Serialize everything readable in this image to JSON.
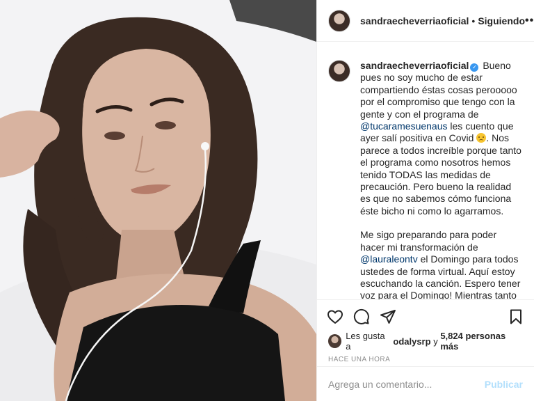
{
  "post": {
    "username": "sandraecheverriaoficial",
    "separator": "•",
    "follow_status": "Siguiendo",
    "more_label": "•••"
  },
  "caption": {
    "username": "sandraecheverriaoficial",
    "text_1": "Bueno pues no soy mucho de estar compartiendo éstas cosas perooooo por el compromiso que tengo con la gente y con el programa de",
    "mention_1": "@tucaramesuenaus",
    "text_2": "les cuento que ayer salí positiva en Covid",
    "text_3": ". Nos parece a todos increíble porque tanto el programa como nosotros hemos tenido TODAS las medidas de precaución. Pero bueno la realidad es que no sabemos cómo funciona éste bicho ni como lo agarramos.",
    "text_4": "Me sigo preparando para poder hacer mi transformación de",
    "mention_2": "@lauraleontv",
    "text_5": "el Domingo para todos ustedes de forma virtual. Aquí estoy escuchando la canción. Espero tener voz para el Domingo! Mientras tanto me cuidaré"
  },
  "icons": {
    "like": "heart-icon",
    "comment": "comment-icon",
    "share": "share-icon",
    "save": "bookmark-icon"
  },
  "likes": {
    "prefix": "Les gusta a",
    "user": "odalysrp",
    "middle": "y",
    "count": "5,824 personas más"
  },
  "timestamp": "HACE UNA HORA",
  "comment_box": {
    "placeholder": "Agrega un comentario...",
    "post_label": "Publicar"
  },
  "colors": {
    "accent": "#3897f0",
    "mention": "#00376b",
    "post_disabled": "#b2dffc"
  }
}
